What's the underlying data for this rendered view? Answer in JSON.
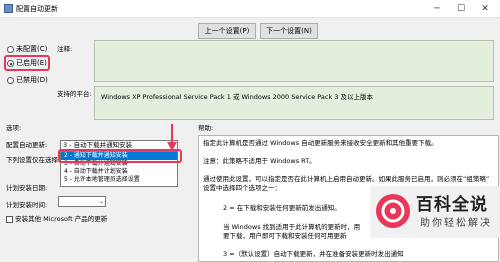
{
  "window": {
    "title": "配置自动更新",
    "minimize": "─",
    "maximize": "☐",
    "close": "✕"
  },
  "state": {
    "not_configured": "未配置(C)",
    "enabled": "已启用(E)",
    "disabled": "已禁用(D)"
  },
  "comment": {
    "label": "注释:"
  },
  "nav": {
    "prev": "上一个设置(P)",
    "next": "下一个设置(N)"
  },
  "supported": {
    "label": "支持的平台:",
    "text": "Windows XP Professional Service Pack 1 或 Windows 2000 Service Pack 3 及以上版本"
  },
  "options": {
    "header": "选项:",
    "configure_label": "配置自动更新:",
    "combo_value": "3 - 自动下载并通知安装",
    "dropdown_items": [
      "2 - 通知下载并通知安装",
      "3 - 自动下载并通知安装",
      "4 - 自动下载并计划安装",
      "5 - 允许本地管理员选择设置"
    ],
    "selected_index": 0,
    "left_labels": [
      "下列设置仅在选择",
      "计划安装日期:",
      "计划安装时间:"
    ],
    "checkbox_label": "安装其他 Microsoft 产品的更新"
  },
  "help": {
    "header": "帮助:",
    "lines": [
      "指定此计算机是否通过 Windows 自动更新服务来接收安全更新和其他重要下载。",
      "注意：此策略不适用于 Windows RT。",
      "通过使用此设置，可以指定是否在此计算机上启用自动更新。如果此服务已启用，则必须在“组策略”",
      "设置中选择四个选项之一：",
      "2 = 在下载和安装任何更新前发出通知。",
      "当 Windows 找到适用于此计算机的更新时，用",
      "要下载，用户即可下载和安装任何可用更新",
      "3 =（默认设置）自动下载更新，并在准备安装更新时发出通知"
    ]
  },
  "watermark": {
    "main": "百科全说",
    "sub": "助你轻松解决"
  },
  "colors": {
    "highlight": "#e8385a",
    "selection": "#0078d7",
    "pane_green": "#e3eedd"
  }
}
